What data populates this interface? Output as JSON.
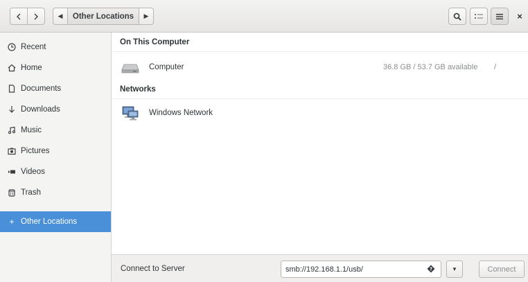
{
  "header": {
    "path_current": "Other Locations"
  },
  "sidebar": {
    "items": [
      {
        "label": "Recent",
        "icon": "clock-icon"
      },
      {
        "label": "Home",
        "icon": "home-icon"
      },
      {
        "label": "Documents",
        "icon": "document-icon"
      },
      {
        "label": "Downloads",
        "icon": "download-icon"
      },
      {
        "label": "Music",
        "icon": "music-icon"
      },
      {
        "label": "Pictures",
        "icon": "camera-icon"
      },
      {
        "label": "Videos",
        "icon": "video-icon"
      },
      {
        "label": "Trash",
        "icon": "trash-icon"
      },
      {
        "label": "Other Locations",
        "icon": "plus-icon",
        "selected": true
      }
    ]
  },
  "main": {
    "sections": [
      {
        "title": "On This Computer",
        "rows": [
          {
            "name": "Computer",
            "info": "36.8 GB / 53.7 GB available",
            "mount": "/",
            "icon": "harddisk-icon"
          }
        ]
      },
      {
        "title": "Networks",
        "rows": [
          {
            "name": "Windows Network",
            "icon": "network-icon"
          }
        ]
      }
    ]
  },
  "actionbar": {
    "label": "Connect to Server",
    "server_value": "smb://192.168.1.1/usb/",
    "connect_label": "Connect"
  },
  "colors": {
    "accent": "#4a90d9",
    "sidebar_bg": "#f4f4f3",
    "header_bg": "#e6e5e3"
  }
}
